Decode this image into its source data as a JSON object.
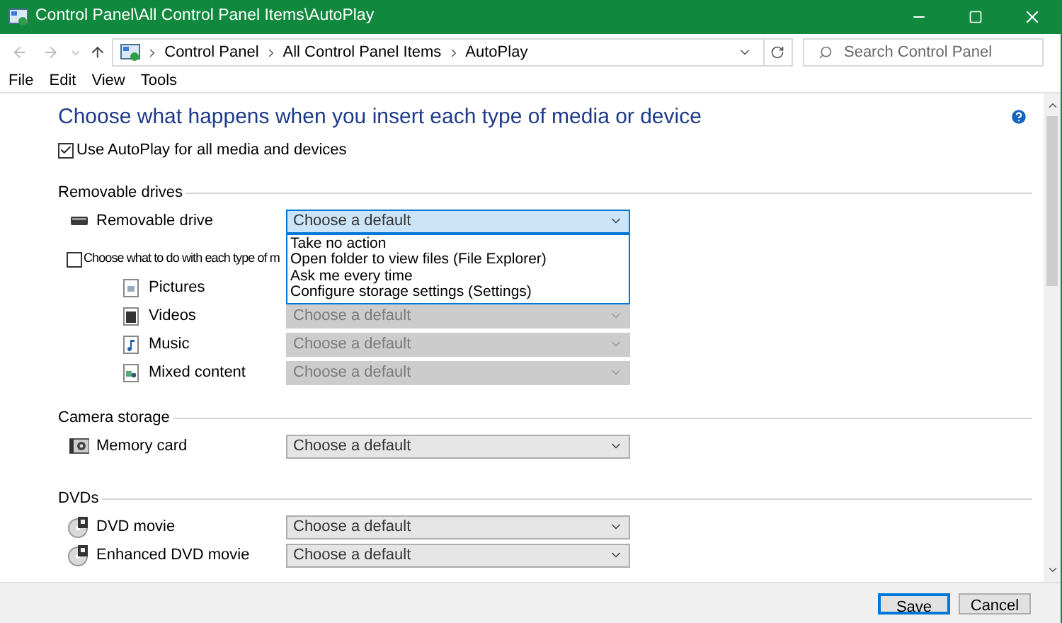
{
  "window": {
    "title": "Control Panel\\All Control Panel Items\\AutoPlay"
  },
  "address": {
    "path": [
      "Control Panel",
      "All Control Panel Items",
      "AutoPlay"
    ],
    "search_placeholder": "Search Control Panel"
  },
  "menu": [
    "File",
    "Edit",
    "View",
    "Tools"
  ],
  "heading": "Choose what happens when you insert each type of media or device",
  "use_autoplay": {
    "label": "Use AutoPlay for all media and devices",
    "checked": true
  },
  "sections": [
    {
      "title": "Removable drives",
      "items": [
        {
          "kind": "drive",
          "label": "Removable drive",
          "value": "Choose a default",
          "disabled": false,
          "open": true,
          "options": [
            "Take no action",
            "Open folder to view files (File Explorer)",
            "Ask me every time",
            "Configure storage settings (Settings)"
          ]
        },
        {
          "kind": "checkbox",
          "label": "Choose what to do with each type of m",
          "checked": false
        },
        {
          "kind": "pictures",
          "label": "Pictures"
        },
        {
          "kind": "videos",
          "label": "Videos",
          "value": "Choose a default",
          "disabled": true
        },
        {
          "kind": "music",
          "label": "Music",
          "value": "Choose a default",
          "disabled": true
        },
        {
          "kind": "mixed",
          "label": "Mixed content",
          "value": "Choose a default",
          "disabled": true
        }
      ]
    },
    {
      "title": "Camera storage",
      "items": [
        {
          "kind": "memory_card",
          "label": "Memory card",
          "value": "Choose a default",
          "disabled": false
        }
      ]
    },
    {
      "title": "DVDs",
      "items": [
        {
          "kind": "dvd",
          "label": "DVD movie",
          "value": "Choose a default",
          "disabled": false
        },
        {
          "kind": "dvd",
          "label": "Enhanced DVD movie",
          "value": "Choose a default",
          "disabled": false
        }
      ]
    }
  ],
  "buttons": [
    {
      "label": "Save",
      "default": true
    },
    {
      "label": "Cancel",
      "default": false
    }
  ]
}
